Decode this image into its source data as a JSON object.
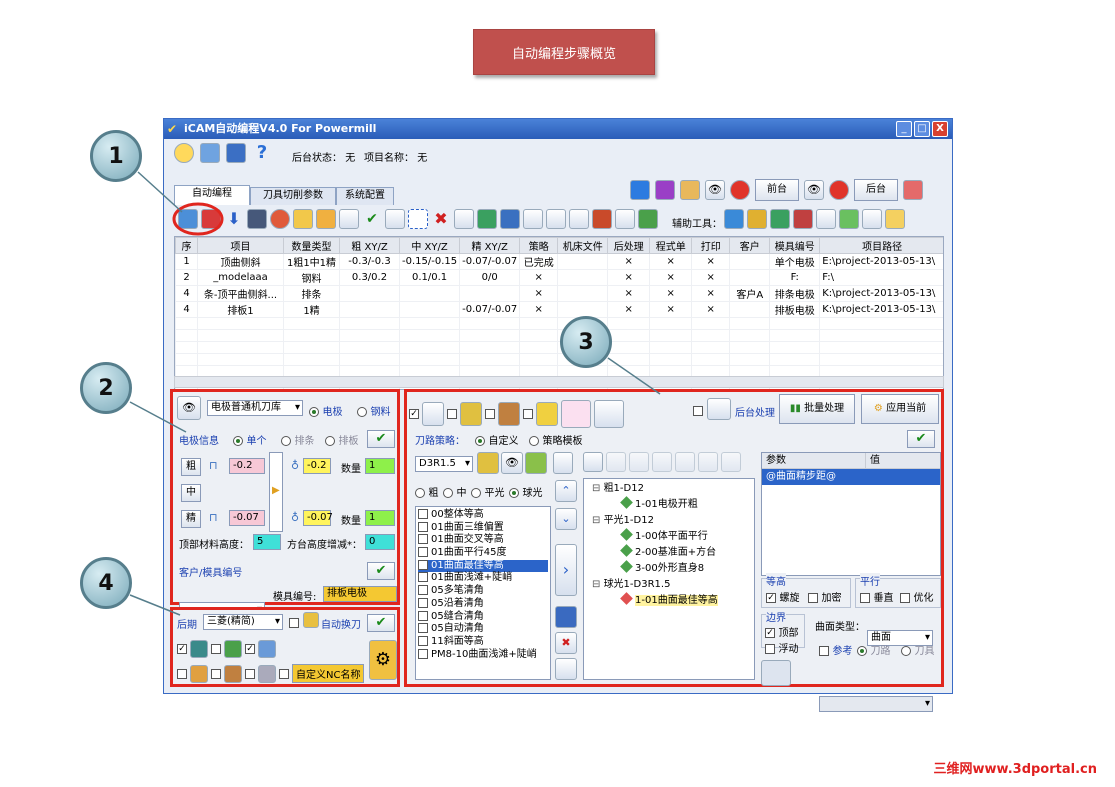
{
  "banner": "自动编程步骤概览",
  "window": {
    "title": "iCAM自动编程V4.0 For Powermill",
    "min": "_",
    "max": "□",
    "close": "X"
  },
  "status": {
    "bg_label": "后台状态：",
    "bg_value": "无",
    "proj_label": "项目名称：",
    "proj_value": "无"
  },
  "tabs": [
    "自动编程",
    "刀具切削参数",
    "系统配置"
  ],
  "right_toolbar": {
    "front": "前台",
    "back": "后台"
  },
  "aux_label": "辅助工具：",
  "table": {
    "headers": [
      "序",
      "项目",
      "数量类型",
      "粗 XY/Z",
      "中 XY/Z",
      "精 XY/Z",
      "策略",
      "机床文件",
      "后处理",
      "程式单",
      "打印",
      "客户",
      "模具编号",
      "项目路径"
    ],
    "rows": [
      [
        "1",
        "顶曲侧斜",
        "1粗1中1精",
        "-0.3/-0.3",
        "-0.15/-0.15",
        "-0.07/-0.07",
        "已完成",
        "",
        "×",
        "×",
        "×",
        "",
        "单个电极",
        "E:\\project-2013-05-13\\"
      ],
      [
        "2",
        "_modelaaa",
        "钢料",
        "0.3/0.2",
        "0.1/0.1",
        "0/0",
        "×",
        "",
        "×",
        "×",
        "×",
        "",
        "F:",
        "F:\\"
      ],
      [
        "4",
        "条-顶平曲侧斜...",
        "排条",
        "",
        "",
        "",
        "×",
        "",
        "×",
        "×",
        "×",
        "客户A",
        "排条电极",
        "K:\\project-2013-05-13\\"
      ],
      [
        "4",
        "排板1",
        "1精",
        "",
        "",
        "-0.07/-0.07",
        "×",
        "",
        "×",
        "×",
        "×",
        "",
        "排板电极",
        "K:\\project-2013-05-13\\"
      ]
    ]
  },
  "callouts": [
    "1",
    "2",
    "3",
    "4"
  ],
  "p2": {
    "library": "电极普通机刀库",
    "electrode": "电极",
    "steel": "钢料",
    "info_label": "电极信息",
    "single": "单个",
    "row": "排条",
    "plate": "排板",
    "rough": "粗",
    "mid": "中",
    "fine": "精",
    "rough_a": "-0.2",
    "rough_b": "-0.2",
    "fine_a": "-0.07",
    "fine_b": "-0.07",
    "qty_label": "数量",
    "qty_rough": "1",
    "qty_fine": "1",
    "top_h_label": "顶部材料高度：",
    "top_h": "5",
    "grid_label": "方台高度增减*：",
    "grid_h": "0",
    "cust_label": "客户/模具编号",
    "mold_label": "模具编号:",
    "mold_value": "排板电极"
  },
  "p4": {
    "post_label": "后期",
    "post_value": "三菱(精简)",
    "auto_tool": "自动换刀",
    "custom_nc": "自定义NC名称"
  },
  "p3": {
    "bg_proc": "后台处理",
    "batch": "批量处理",
    "apply": "应用当前",
    "strategy_label": "刀路策略：",
    "custom": "自定义",
    "template": "策略模板",
    "tool": "D3R1.5",
    "r_rough": "粗",
    "r_mid": "中",
    "r_flat": "平光",
    "r_ball": "球光",
    "strategies": [
      "00整体等高",
      "01曲面三维偏置",
      "01曲面交叉等高",
      "01曲面平行45度",
      "01曲面最佳等高",
      "01曲面浅滩+陡峭",
      "05多笔清角",
      "05沿着清角",
      "05缝合清角",
      "05自动清角",
      "11斜面等高",
      "PM8-10曲面浅滩+陡峭"
    ],
    "selected_index": 4,
    "tree": [
      {
        "label": "粗1-D12",
        "level": 0
      },
      {
        "label": "1-01电极开粗",
        "level": 1
      },
      {
        "label": "平光1-D12",
        "level": 0
      },
      {
        "label": "1-00体平面平行",
        "level": 1
      },
      {
        "label": "2-00基准面+方台",
        "level": 1
      },
      {
        "label": "3-00外形直身8",
        "level": 1
      },
      {
        "label": "球光1-D3R1.5",
        "level": 0
      },
      {
        "label": "1-01曲面最佳等高",
        "level": 1
      }
    ],
    "param_col": "参数",
    "value_col": "值",
    "param_row": "@曲面精步距@",
    "contour": "等高",
    "spiral": "螺旋",
    "accel": "加密",
    "parallel": "平行",
    "vertical": "垂直",
    "optimize": "优化",
    "boundary": "边界",
    "top": "顶部",
    "float": "浮动",
    "surf_type_label": "曲面类型：",
    "surf_type": "曲面",
    "ref": "参考",
    "path": "刀路",
    "cutter": "刀具"
  },
  "watermark": "三维网www.3dportal.cn"
}
